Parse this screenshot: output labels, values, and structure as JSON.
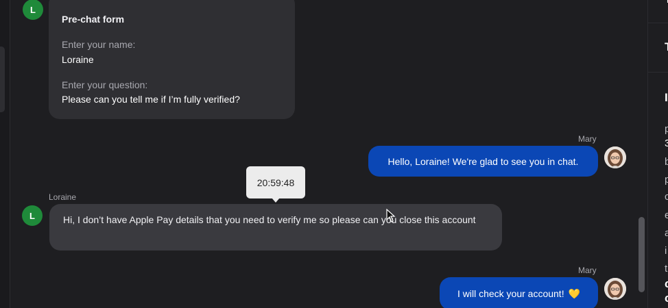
{
  "prechat": {
    "avatar_letter": "L",
    "title": "Pre-chat form",
    "name_label": "Enter your name:",
    "name_value": "Loraine",
    "question_label": "Enter your question:",
    "question_value": "Please can you tell me if I’m fully verified?"
  },
  "messages": [
    {
      "sender": "Mary",
      "text": "Hello, Loraine! We're glad to see you in chat."
    },
    {
      "sender": "Loraine",
      "avatar_letter": "L",
      "text": "Hi, I don’t have Apple Pay details that you need to verify me so please can you close this account"
    },
    {
      "sender": "Mary",
      "text": "I will check your account!",
      "emoji": "💛"
    }
  ],
  "tooltip": {
    "time": "20:59:48"
  },
  "right_panel": {
    "lines": [
      "T",
      "T",
      "I",
      "p",
      "3",
      "b",
      "p",
      "c",
      "e",
      "a",
      "i",
      "t",
      "c",
      "c"
    ]
  },
  "colors": {
    "background": "#1e1e21",
    "agent_bubble": "#0b47b5",
    "customer_bubble": "#3a3a3f",
    "avatar_green": "#1f8a3a"
  }
}
